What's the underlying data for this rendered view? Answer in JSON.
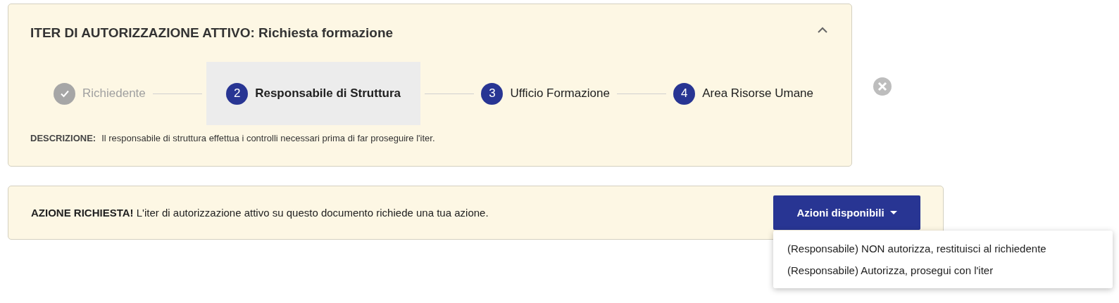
{
  "iter_panel": {
    "title": "ITER DI AUTORIZZAZIONE ATTIVO: Richiesta formazione",
    "expanded": true,
    "steps": [
      {
        "label": "Richiedente",
        "kind": "done",
        "selected": false
      },
      {
        "number": "2",
        "label": "Responsabile di Struttura",
        "kind": "active",
        "selected": true
      },
      {
        "number": "3",
        "label": "Ufficio Formazione",
        "kind": "pending",
        "selected": false
      },
      {
        "number": "4",
        "label": "Area Risorse Umane",
        "kind": "pending",
        "selected": false
      }
    ],
    "description_label": "DESCRIZIONE:",
    "description": "Il responsabile di struttura effettua i controlli necessari prima di far proseguire l'iter."
  },
  "action_panel": {
    "message": "**AZIONE RICHIESTA!** L'iter di autorizzazione attivo su questo documento richiede una tua azione.",
    "button": "Azioni disponibili",
    "menu_open": true,
    "menu_items": [
      "(Responsabile) NON autorizza, restituisci al richiedente",
      "(Responsabile) Autorizza, prosegui con l'iter"
    ]
  }
}
